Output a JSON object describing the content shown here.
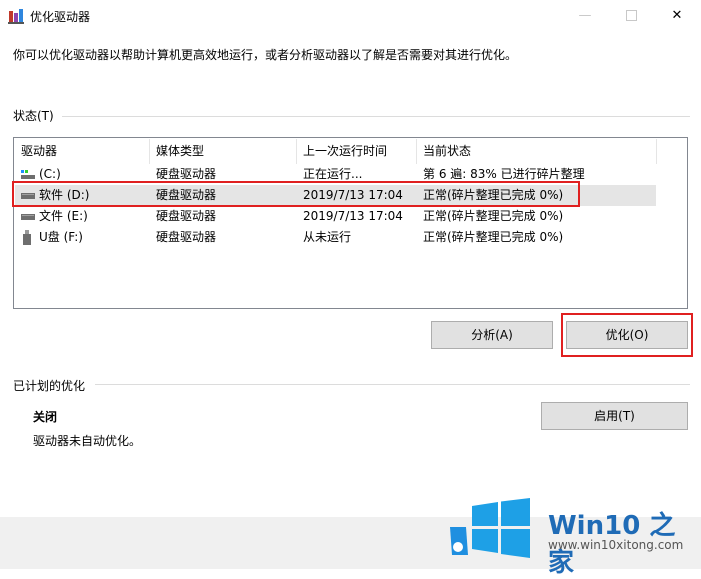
{
  "window": {
    "title": "优化驱动器"
  },
  "intro_text": "你可以优化驱动器以帮助计算机更高效地运行，或者分析驱动器以了解是否需要对其进行优化。",
  "status_section": {
    "label": "状态(T)"
  },
  "table": {
    "columns": [
      "驱动器",
      "媒体类型",
      "上一次运行时间",
      "当前状态"
    ],
    "rows": [
      {
        "drive": "(C:)",
        "media": "硬盘驱动器",
        "last_run": "正在运行...",
        "status": "第 6 遍: 83% 已进行碎片整理",
        "icon": "system-drive-icon"
      },
      {
        "drive": "软件 (D:)",
        "media": "硬盘驱动器",
        "last_run": "2019/7/13 17:04",
        "status": "正常(碎片整理已完成 0%)",
        "icon": "hard-drive-icon"
      },
      {
        "drive": "文件 (E:)",
        "media": "硬盘驱动器",
        "last_run": "2019/7/13 17:04",
        "status": "正常(碎片整理已完成 0%)",
        "icon": "hard-drive-icon"
      },
      {
        "drive": "U盘 (F:)",
        "media": "硬盘驱动器",
        "last_run": "从未运行",
        "status": "正常(碎片整理已完成 0%)",
        "icon": "usb-drive-icon"
      }
    ]
  },
  "buttons": {
    "analyze": "分析(A)",
    "optimize": "优化(O)",
    "enable": "启用(T)"
  },
  "scheduled": {
    "label": "已计划的优化",
    "state": "关闭",
    "description": "驱动器未自动优化。"
  },
  "watermark": {
    "brand": "Win10 之家",
    "url": "www.win10xitong.com"
  },
  "colors": {
    "highlight": "#e02020",
    "selection": "#e5e5e5",
    "brand_blue": "#1f6bb6"
  }
}
